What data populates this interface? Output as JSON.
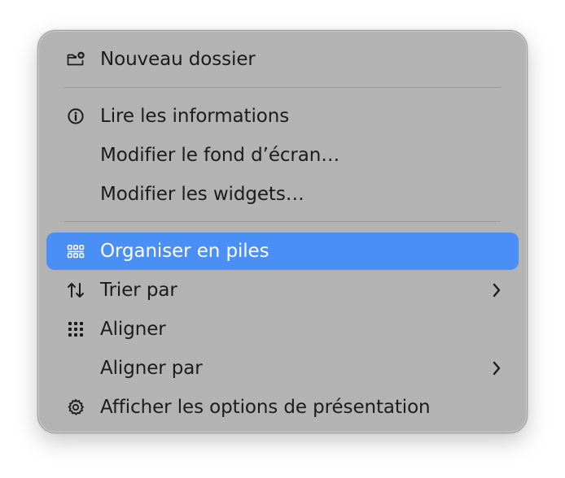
{
  "menu": {
    "items": [
      {
        "label": "Nouveau dossier",
        "icon": "new-folder-icon"
      },
      {
        "label": "Lire les informations",
        "icon": "info-icon"
      },
      {
        "label": "Modifier le fond d’écran…"
      },
      {
        "label": "Modifier les widgets…"
      },
      {
        "label": "Organiser en piles",
        "icon": "stacks-icon",
        "highlighted": true
      },
      {
        "label": "Trier par",
        "icon": "sort-arrows-icon",
        "submenu": true
      },
      {
        "label": "Aligner",
        "icon": "grid-icon"
      },
      {
        "label": "Aligner par",
        "submenu": true
      },
      {
        "label": "Afficher les options de présentation",
        "icon": "gear-icon"
      }
    ]
  },
  "colors": {
    "menu_background": "#b3b3b3",
    "highlight": "#4a8ff5",
    "text": "#1c1c1c",
    "highlight_text": "#ffffff"
  }
}
